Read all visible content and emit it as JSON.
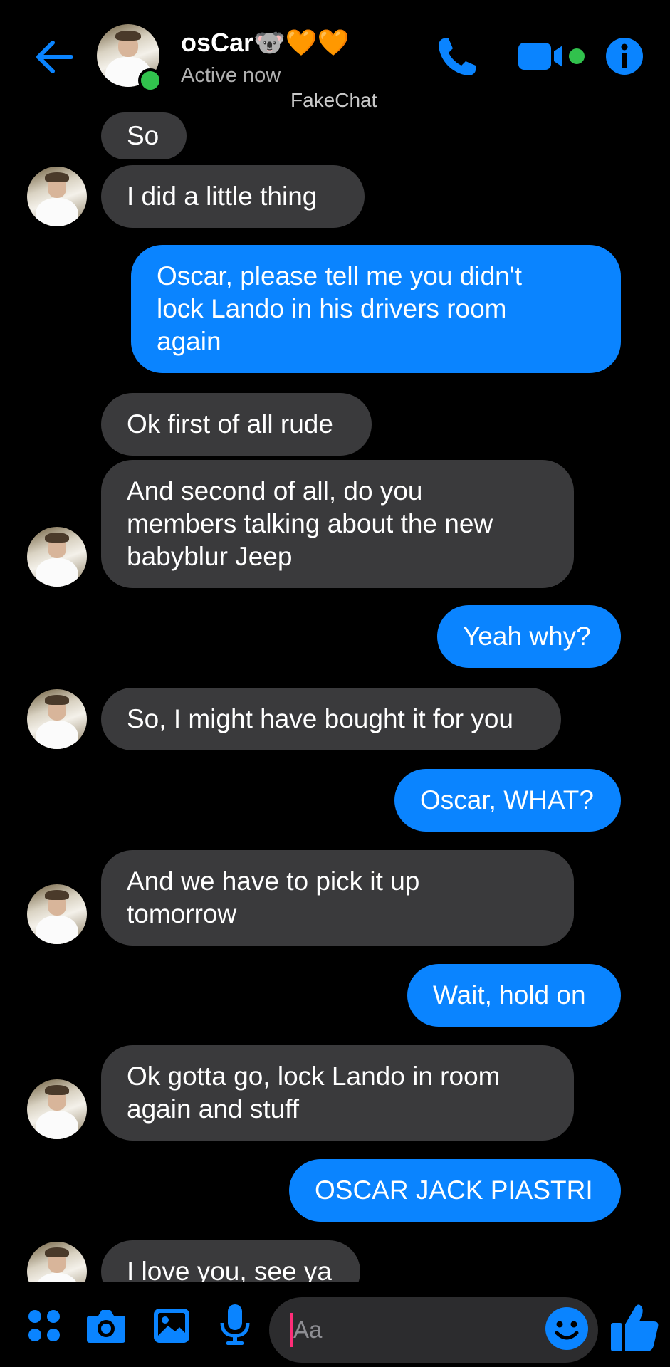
{
  "header": {
    "contact_name": "osCar🐨🧡🧡",
    "status": "Active now",
    "watermark": "FakeChat",
    "back_icon": "arrow-left-icon",
    "call_icon": "phone-icon",
    "video_icon": "video-camera-icon",
    "info_icon": "info-icon"
  },
  "messages": [
    {
      "side": "in",
      "text": "So",
      "avatar": false
    },
    {
      "side": "in",
      "text": "I did a little thing",
      "avatar": true
    },
    {
      "side": "out",
      "text": "Oscar, please tell me you didn't\nlock Lando in his drivers room\nagain"
    },
    {
      "side": "in",
      "text": "Ok first of all rude",
      "avatar": false
    },
    {
      "side": "in",
      "text": "And second of all, do you\nmembers talking about the new\nbabyblur Jeep",
      "avatar": true
    },
    {
      "side": "out",
      "text": "Yeah why?"
    },
    {
      "side": "in",
      "text": "So, I might have bought it for you",
      "avatar": true
    },
    {
      "side": "out",
      "text": "Oscar, WHAT?"
    },
    {
      "side": "in",
      "text": "And we have to pick it up\ntomorrow",
      "avatar": true
    },
    {
      "side": "out",
      "text": "Wait, hold on"
    },
    {
      "side": "in",
      "text": "Ok gotta go, lock Lando in room\nagain and stuff",
      "avatar": true
    },
    {
      "side": "out",
      "text": "OSCAR JACK PIASTRI"
    },
    {
      "side": "in",
      "text": "I love you, see ya",
      "avatar": true
    }
  ],
  "composer": {
    "placeholder": "Aa",
    "apps_icon": "apps-grid-icon",
    "camera_icon": "camera-icon",
    "gallery_icon": "image-icon",
    "mic_icon": "microphone-icon",
    "emoji_icon": "smiley-icon",
    "like_icon": "thumbs-up-icon"
  },
  "colors": {
    "accent": "#0a84ff",
    "incoming_bubble": "#3a3a3c",
    "background": "#000000",
    "online": "#31c24d"
  }
}
